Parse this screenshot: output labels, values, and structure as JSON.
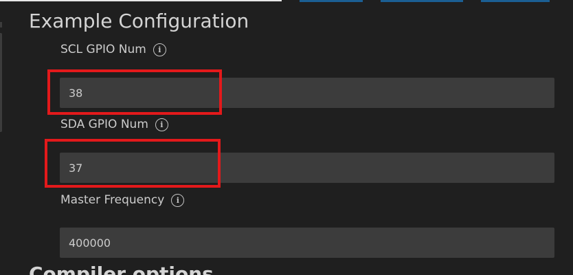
{
  "section": {
    "title": "Example Configuration",
    "next_title": "Compiler options"
  },
  "fields": [
    {
      "label": "SCL GPIO Num",
      "value": "38",
      "info_icon": "info-icon"
    },
    {
      "label": "SDA GPIO Num",
      "value": "37",
      "info_icon": "info-icon"
    },
    {
      "label": "Master Frequency",
      "value": "400000",
      "info_icon": "info-icon"
    }
  ],
  "annotations": {
    "highlight_color": "#e3191b",
    "highlighted_fields": [
      "SCL GPIO Num",
      "SDA GPIO Num"
    ]
  },
  "colors": {
    "background": "#1f1f1f",
    "input_background": "#3c3c3c",
    "text": "#cccccc",
    "accent_button": "#1b5f93"
  }
}
